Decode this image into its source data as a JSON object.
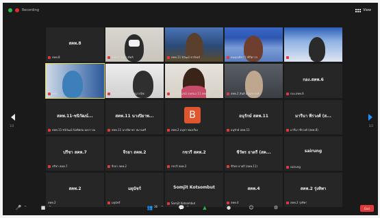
{
  "recording": {
    "label": "Recording"
  },
  "view": {
    "label": "View"
  },
  "pages": {
    "left": "1/2",
    "right": "1/2"
  },
  "tiles": [
    {
      "name": "สคพ.8",
      "label": "สคพ.8"
    },
    {
      "name": "",
      "label": "สคพ.7 นิตยา ติดลิ"
    },
    {
      "name": "",
      "label": "สคพ.11 นิวัฒน์ ชาร์ทอร์"
    },
    {
      "name": "",
      "label": "คนคุณทิชา ไวทีวิดาวร"
    },
    {
      "name": "",
      "label": "สคพ.ทัศพร อินวิน"
    },
    {
      "name": "",
      "label": "สคพ."
    },
    {
      "name": "",
      "label": "สคพ.2 สันต์เรซ ภาณุวาณิช"
    },
    {
      "name": "",
      "label": "นพนีย์ สุนรณ์ ลบพนภ.11 สคพ.8"
    },
    {
      "name": "",
      "label": "สคพ.2 สันต์ อัญประสงค์"
    },
    {
      "name": "กอง.สคพ.6",
      "label": "กอง.สคพ.6"
    },
    {
      "name": "สคพ.11-ชนิวัฒน์...",
      "label": "สคพ.11-ชนิวัฒน์ นิลทิศสม ผลภาวณ"
    },
    {
      "name": "สคพ.11 นางปิยาพ...",
      "label": "สคพ.11 นางปิยาพา สมานศรี"
    },
    {
      "name": "",
      "label": "สคพ.2 อนุชา ทองเรือง"
    },
    {
      "name": "อนุรักษ์ สคพ.11",
      "label": "อนุรักษ์ สคพ.11"
    },
    {
      "name": "มารีนา พีรวงศ์ (ส...",
      "label": "มารีนา พีรวงศ์ (สคพ.8)"
    },
    {
      "name": "ปรีชา สคพ.7",
      "label": "ปรีชา สคพ.7"
    },
    {
      "name": "จีรยา สคพ.2",
      "label": "จีรยา สคพ.2"
    },
    {
      "name": "กชวรี สคพ.2",
      "label": "กชวรี สคพ.2"
    },
    {
      "name": "ชีวัพร ธาตรี (สค...",
      "label": "ชีวัพร ธาตรี (สคพ.11)"
    },
    {
      "name": "sairung",
      "label": "sairung"
    },
    {
      "name": "สคพ.2",
      "label": "สคพ.2"
    },
    {
      "name": "มยุนัชร์",
      "label": "มยุนัชร์"
    },
    {
      "name": "Somjit Kotsombut",
      "label": "Somjit Kotsombut"
    },
    {
      "name": "สคพ.4",
      "label": "สคพ.4"
    },
    {
      "name": "สคพ.2 รุ่งทิพา",
      "label": "สคพ.2 รุ่งทิพา"
    }
  ],
  "avatar": {
    "letter": "B"
  },
  "toolbar": {
    "participants_count": "36",
    "end_label": "End"
  },
  "colors": {
    "accent": "#1e90ff",
    "mute": "#e23a3a",
    "avatar": "#e0562f",
    "active": "#e8d94a"
  }
}
